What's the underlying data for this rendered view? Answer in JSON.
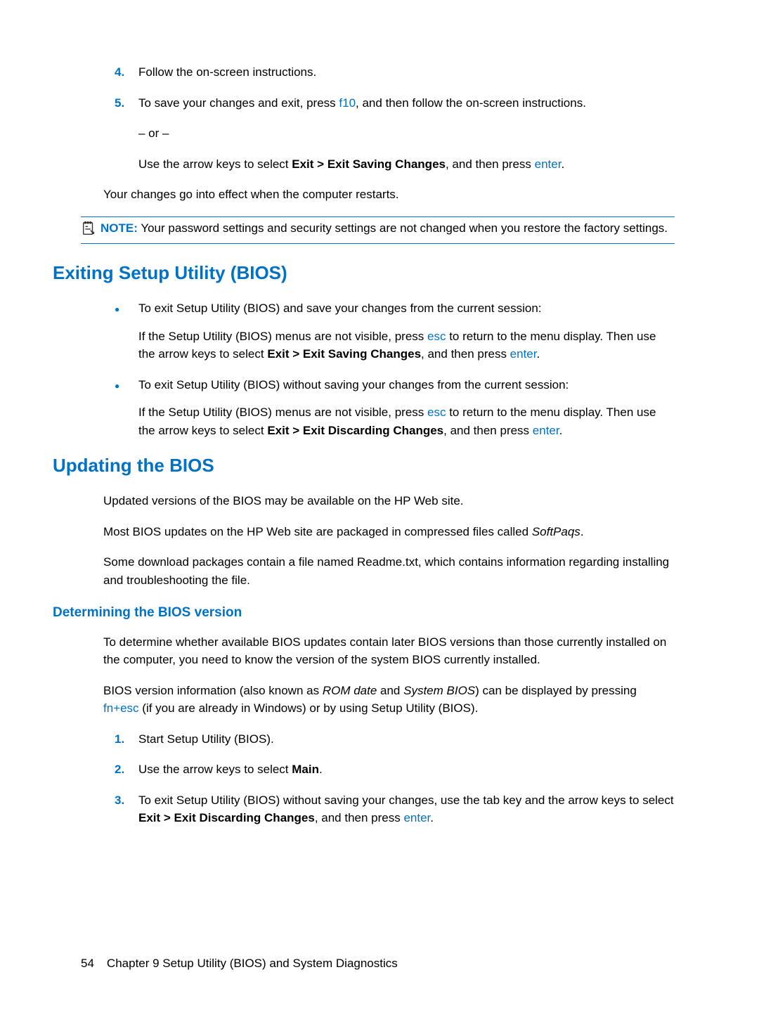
{
  "step4": {
    "num": "4.",
    "text": "Follow the on-screen instructions."
  },
  "step5": {
    "num": "5.",
    "pre": "To save your changes and exit, press ",
    "key": "f10",
    "post": ", and then follow the on-screen instructions.",
    "or": "– or –",
    "alt_pre": "Use the arrow keys to select ",
    "alt_bold": "Exit > Exit Saving Changes",
    "alt_mid": ", and then press ",
    "alt_key": "enter",
    "alt_post": "."
  },
  "restart_line": "Your changes go into effect when the computer restarts.",
  "note": {
    "label": "NOTE:",
    "text": "Your password settings and security settings are not changed when you restore the factory settings."
  },
  "h_exit": "Exiting Setup Utility (BIOS)",
  "exit1": {
    "lead": "To exit Setup Utility (BIOS) and save your changes from the current session:",
    "sub_pre": "If the Setup Utility (BIOS) menus are not visible, press ",
    "sub_key1": "esc",
    "sub_mid1": " to return to the menu display. Then use the arrow keys to select ",
    "sub_bold": "Exit > Exit Saving Changes",
    "sub_mid2": ", and then press ",
    "sub_key2": "enter",
    "sub_post": "."
  },
  "exit2": {
    "lead": "To exit Setup Utility (BIOS) without saving your changes from the current session:",
    "sub_pre": "If the Setup Utility (BIOS) menus are not visible, press ",
    "sub_key1": "esc",
    "sub_mid1": " to return to the menu display. Then use the arrow keys to select ",
    "sub_bold": "Exit > Exit Discarding Changes",
    "sub_mid2": ", and then press ",
    "sub_key2": "enter",
    "sub_post": "."
  },
  "h_update": "Updating the BIOS",
  "update_p1": "Updated versions of the BIOS may be available on the HP Web site.",
  "update_p2_pre": "Most BIOS updates on the HP Web site are packaged in compressed files called ",
  "update_p2_it": "SoftPaqs",
  "update_p2_post": ".",
  "update_p3": "Some download packages contain a file named Readme.txt, which contains information regarding installing and troubleshooting the file.",
  "h_determine": "Determining the BIOS version",
  "det_p1": "To determine whether available BIOS updates contain later BIOS versions than those currently installed on the computer, you need to know the version of the system BIOS currently installed.",
  "det_p2_pre": "BIOS version information (also known as ",
  "det_p2_it1": "ROM date",
  "det_p2_mid": " and ",
  "det_p2_it2": "System BIOS",
  "det_p2_post1": ") can be displayed by pressing ",
  "det_p2_key": "fn+esc",
  "det_p2_post2": " (if you are already in Windows) or by using Setup Utility (BIOS).",
  "det_s1": {
    "num": "1.",
    "text": "Start Setup Utility (BIOS)."
  },
  "det_s2": {
    "num": "2.",
    "pre": "Use the arrow keys to select ",
    "bold": "Main",
    "post": "."
  },
  "det_s3": {
    "num": "3.",
    "pre": "To exit Setup Utility (BIOS) without saving your changes, use the tab key and the arrow keys to select ",
    "bold": "Exit > Exit Discarding Changes",
    "mid": ", and then press ",
    "key": "enter",
    "post": "."
  },
  "footer": {
    "pagenum": "54",
    "chapter": "Chapter 9   Setup Utility (BIOS) and System Diagnostics"
  }
}
